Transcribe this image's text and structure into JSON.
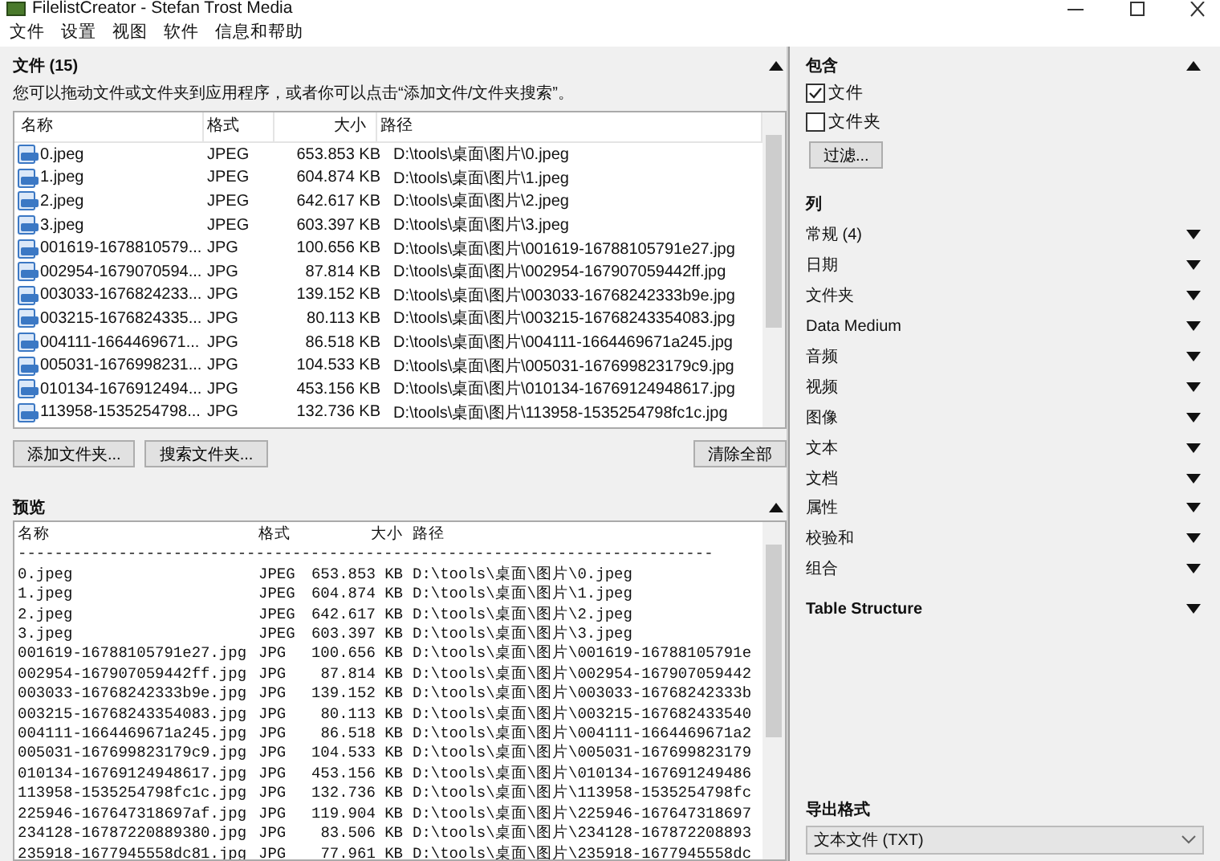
{
  "window": {
    "title": "FilelistCreator - Stefan Trost Media"
  },
  "menu": [
    "文件",
    "设置",
    "视图",
    "软件",
    "信息和帮助"
  ],
  "files_panel": {
    "title": "文件 (15)",
    "hint": "您可以拖动文件或文件夹到应用程序，或者你可以点击“添加文件/文件夹搜索”。",
    "columns": [
      "名称",
      "格式",
      "大小",
      "路径"
    ],
    "rows": [
      {
        "name": "0.jpeg",
        "format": "JPEG",
        "size": "653.853 KB",
        "path": "D:\\tools\\桌面\\图片\\0.jpeg"
      },
      {
        "name": "1.jpeg",
        "format": "JPEG",
        "size": "604.874 KB",
        "path": "D:\\tools\\桌面\\图片\\1.jpeg"
      },
      {
        "name": "2.jpeg",
        "format": "JPEG",
        "size": "642.617 KB",
        "path": "D:\\tools\\桌面\\图片\\2.jpeg"
      },
      {
        "name": "3.jpeg",
        "format": "JPEG",
        "size": "603.397 KB",
        "path": "D:\\tools\\桌面\\图片\\3.jpeg"
      },
      {
        "name": "001619-1678810579...",
        "format": "JPG",
        "size": "100.656 KB",
        "path": "D:\\tools\\桌面\\图片\\001619-16788105791e27.jpg"
      },
      {
        "name": "002954-1679070594...",
        "format": "JPG",
        "size": "87.814 KB",
        "path": "D:\\tools\\桌面\\图片\\002954-167907059442ff.jpg"
      },
      {
        "name": "003033-1676824233...",
        "format": "JPG",
        "size": "139.152 KB",
        "path": "D:\\tools\\桌面\\图片\\003033-16768242333b9e.jpg"
      },
      {
        "name": "003215-1676824335...",
        "format": "JPG",
        "size": "80.113 KB",
        "path": "D:\\tools\\桌面\\图片\\003215-16768243354083.jpg"
      },
      {
        "name": "004111-1664469671...",
        "format": "JPG",
        "size": "86.518 KB",
        "path": "D:\\tools\\桌面\\图片\\004111-1664469671a245.jpg"
      },
      {
        "name": "005031-1676998231...",
        "format": "JPG",
        "size": "104.533 KB",
        "path": "D:\\tools\\桌面\\图片\\005031-167699823179c9.jpg"
      },
      {
        "name": "010134-1676912494...",
        "format": "JPG",
        "size": "453.156 KB",
        "path": "D:\\tools\\桌面\\图片\\010134-16769124948617.jpg"
      },
      {
        "name": "113958-1535254798...",
        "format": "JPG",
        "size": "132.736 KB",
        "path": "D:\\tools\\桌面\\图片\\113958-1535254798fc1c.jpg"
      }
    ],
    "buttons": [
      "添加文件夹...",
      "搜索文件夹..."
    ],
    "clear_button": "清除全部"
  },
  "preview": {
    "title": "预览",
    "columns": [
      "名称",
      "格式",
      "大小",
      "路径"
    ],
    "separator": "----------------------------------------------------------------------------",
    "rows": [
      {
        "name": "0.jpeg",
        "format": "JPEG",
        "size": "653.853 KB",
        "path": "D:\\tools\\桌面\\图片\\0.jpeg"
      },
      {
        "name": "1.jpeg",
        "format": "JPEG",
        "size": "604.874 KB",
        "path": "D:\\tools\\桌面\\图片\\1.jpeg"
      },
      {
        "name": "2.jpeg",
        "format": "JPEG",
        "size": "642.617 KB",
        "path": "D:\\tools\\桌面\\图片\\2.jpeg"
      },
      {
        "name": "3.jpeg",
        "format": "JPEG",
        "size": "603.397 KB",
        "path": "D:\\tools\\桌面\\图片\\3.jpeg"
      },
      {
        "name": "001619-16788105791e27.jpg",
        "format": "JPG",
        "size": "100.656 KB",
        "path": "D:\\tools\\桌面\\图片\\001619-16788105791e"
      },
      {
        "name": "002954-167907059442ff.jpg",
        "format": "JPG",
        "size": "87.814 KB",
        "path": "D:\\tools\\桌面\\图片\\002954-167907059442"
      },
      {
        "name": "003033-16768242333b9e.jpg",
        "format": "JPG",
        "size": "139.152 KB",
        "path": "D:\\tools\\桌面\\图片\\003033-16768242333b"
      },
      {
        "name": "003215-16768243354083.jpg",
        "format": "JPG",
        "size": "80.113 KB",
        "path": "D:\\tools\\桌面\\图片\\003215-167682433540"
      },
      {
        "name": "004111-1664469671a245.jpg",
        "format": "JPG",
        "size": "86.518 KB",
        "path": "D:\\tools\\桌面\\图片\\004111-1664469671a2"
      },
      {
        "name": "005031-167699823179c9.jpg",
        "format": "JPG",
        "size": "104.533 KB",
        "path": "D:\\tools\\桌面\\图片\\005031-167699823179"
      },
      {
        "name": "010134-16769124948617.jpg",
        "format": "JPG",
        "size": "453.156 KB",
        "path": "D:\\tools\\桌面\\图片\\010134-167691249486"
      },
      {
        "name": "113958-1535254798fc1c.jpg",
        "format": "JPG",
        "size": "132.736 KB",
        "path": "D:\\tools\\桌面\\图片\\113958-1535254798fc"
      },
      {
        "name": "225946-167647318697af.jpg",
        "format": "JPG",
        "size": "119.904 KB",
        "path": "D:\\tools\\桌面\\图片\\225946-167647318697"
      },
      {
        "name": "234128-16787220889380.jpg",
        "format": "JPG",
        "size": "83.506 KB",
        "path": "D:\\tools\\桌面\\图片\\234128-167872208893"
      },
      {
        "name": "235918-1677945558dc81.jpg",
        "format": "JPG",
        "size": "77.961 KB",
        "path": "D:\\tools\\桌面\\图片\\235918-1677945558dc"
      }
    ]
  },
  "include": {
    "title": "包含",
    "checks": [
      {
        "label": "文件",
        "checked": true
      },
      {
        "label": "文件夹",
        "checked": false
      }
    ],
    "filter_button": "过滤..."
  },
  "columns_panel": {
    "title": "列",
    "groups": [
      "常规 (4)",
      "日期",
      "文件夹",
      "Data Medium",
      "音频",
      "视频",
      "图像",
      "文本",
      "文档",
      "属性",
      "校验和",
      "组合"
    ]
  },
  "table_structure": {
    "title": "Table Structure"
  },
  "export": {
    "title": "导出格式",
    "value": "文本文件 (TXT)"
  }
}
